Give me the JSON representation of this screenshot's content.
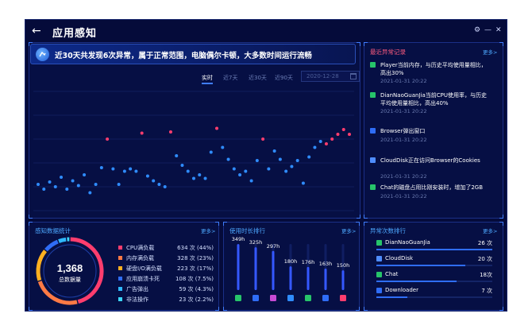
{
  "window": {
    "title": "应用感知",
    "back_label": "←",
    "settings_label": "⚙",
    "minimize_label": "—",
    "close_label": "✕"
  },
  "banner": {
    "text": "近30天共发现6次异常，属于正常范围，电脑偶尔卡顿，大多数时间运行流畅"
  },
  "time_tabs": [
    {
      "label": "实时",
      "active": true
    },
    {
      "label": "近7天",
      "active": false
    },
    {
      "label": "近30天",
      "active": false
    },
    {
      "label": "近90天",
      "active": false
    }
  ],
  "date_picker": {
    "value": "2020-12-28"
  },
  "chart_data": [
    {
      "type": "scatter",
      "title": "",
      "xlabel": "",
      "ylabel": "",
      "ylim": [
        0,
        100
      ],
      "grid": true,
      "normal_color": "#2f8cff",
      "abnormal_color": "#ff3d6e",
      "points": [
        {
          "x": 1,
          "y": 22,
          "abnormal": false
        },
        {
          "x": 2,
          "y": 18,
          "abnormal": false
        },
        {
          "x": 3,
          "y": 24,
          "abnormal": false
        },
        {
          "x": 4,
          "y": 20,
          "abnormal": false
        },
        {
          "x": 5,
          "y": 28,
          "abnormal": false
        },
        {
          "x": 6,
          "y": 18,
          "abnormal": false
        },
        {
          "x": 7,
          "y": 25,
          "abnormal": false
        },
        {
          "x": 8,
          "y": 21,
          "abnormal": false
        },
        {
          "x": 9,
          "y": 30,
          "abnormal": false
        },
        {
          "x": 10,
          "y": 15,
          "abnormal": false
        },
        {
          "x": 11,
          "y": 22,
          "abnormal": false
        },
        {
          "x": 12,
          "y": 36,
          "abnormal": false
        },
        {
          "x": 13,
          "y": 60,
          "abnormal": true
        },
        {
          "x": 14,
          "y": 35,
          "abnormal": false
        },
        {
          "x": 15,
          "y": 22,
          "abnormal": false
        },
        {
          "x": 16,
          "y": 33,
          "abnormal": false
        },
        {
          "x": 17,
          "y": 35,
          "abnormal": false
        },
        {
          "x": 18,
          "y": 33,
          "abnormal": false
        },
        {
          "x": 19,
          "y": 65,
          "abnormal": true
        },
        {
          "x": 20,
          "y": 29,
          "abnormal": false
        },
        {
          "x": 21,
          "y": 25,
          "abnormal": false
        },
        {
          "x": 22,
          "y": 22,
          "abnormal": false
        },
        {
          "x": 23,
          "y": 20,
          "abnormal": false
        },
        {
          "x": 24,
          "y": 66,
          "abnormal": true
        },
        {
          "x": 25,
          "y": 46,
          "abnormal": false
        },
        {
          "x": 26,
          "y": 38,
          "abnormal": false
        },
        {
          "x": 27,
          "y": 33,
          "abnormal": false
        },
        {
          "x": 28,
          "y": 27,
          "abnormal": false
        },
        {
          "x": 29,
          "y": 30,
          "abnormal": false
        },
        {
          "x": 30,
          "y": 27,
          "abnormal": false
        },
        {
          "x": 31,
          "y": 49,
          "abnormal": false
        },
        {
          "x": 32,
          "y": 69,
          "abnormal": true
        },
        {
          "x": 33,
          "y": 53,
          "abnormal": false
        },
        {
          "x": 34,
          "y": 43,
          "abnormal": false
        },
        {
          "x": 35,
          "y": 35,
          "abnormal": false
        },
        {
          "x": 36,
          "y": 30,
          "abnormal": false
        },
        {
          "x": 37,
          "y": 33,
          "abnormal": false
        },
        {
          "x": 38,
          "y": 25,
          "abnormal": false
        },
        {
          "x": 39,
          "y": 42,
          "abnormal": false
        },
        {
          "x": 40,
          "y": 60,
          "abnormal": true
        },
        {
          "x": 41,
          "y": 35,
          "abnormal": false
        },
        {
          "x": 42,
          "y": 50,
          "abnormal": false
        },
        {
          "x": 43,
          "y": 43,
          "abnormal": false
        },
        {
          "x": 44,
          "y": 33,
          "abnormal": false
        },
        {
          "x": 45,
          "y": 37,
          "abnormal": false
        },
        {
          "x": 46,
          "y": 42,
          "abnormal": false
        },
        {
          "x": 47,
          "y": 23,
          "abnormal": false
        },
        {
          "x": 48,
          "y": 45,
          "abnormal": false
        },
        {
          "x": 49,
          "y": 53,
          "abnormal": false
        },
        {
          "x": 50,
          "y": 58,
          "abnormal": false
        },
        {
          "x": 51,
          "y": 56,
          "abnormal": true
        },
        {
          "x": 52,
          "y": 60,
          "abnormal": true
        },
        {
          "x": 53,
          "y": 64,
          "abnormal": true
        },
        {
          "x": 54,
          "y": 68,
          "abnormal": true
        },
        {
          "x": 55,
          "y": 64,
          "abnormal": true
        }
      ]
    },
    {
      "type": "pie",
      "title": "感知数据统计",
      "center_value": "1,368",
      "center_label": "总数据量",
      "slices": [
        {
          "name": "CPU满负载",
          "value": 634,
          "label": "634 次 (44%)",
          "color": "#ff3d6e"
        },
        {
          "name": "内存满负载",
          "value": 328,
          "label": "328 次 (23%)",
          "color": "#ff7a45"
        },
        {
          "name": "硬盘I/O满负载",
          "value": 223,
          "label": "223 次 (17%)",
          "color": "#ffb020"
        },
        {
          "name": "应用崩溃卡死",
          "value": 108,
          "label": "108 次 (7.5%)",
          "color": "#2f6df6"
        },
        {
          "name": "广告弹出",
          "value": 59,
          "label": "59 次 (4.3%)",
          "color": "#2fb8ff"
        },
        {
          "name": "非法操作",
          "value": 23,
          "label": "23 次 (2.2%)",
          "color": "#3cd6ff"
        }
      ]
    },
    {
      "type": "bar",
      "title": "使用时长排行",
      "ylim": [
        0,
        350
      ],
      "categories": [
        "wechat",
        "360",
        "game",
        "cloud",
        "green",
        "download",
        "red"
      ],
      "values": [
        349,
        325,
        297,
        180,
        176,
        163,
        150
      ],
      "labels": [
        "349h",
        "325h",
        "297h",
        "180h",
        "176h",
        "163h",
        "150h"
      ],
      "icon_colors": [
        "#27c46a",
        "#2f6df6",
        "#c84bd6",
        "#2f8cff",
        "#27c46a",
        "#2f6df6",
        "#ff3d6e"
      ]
    }
  ],
  "more_label": "更多>",
  "records": {
    "title": "最近异常记录",
    "items": [
      {
        "text": "Player当前内存，与历史平均使用量相比，高出30%",
        "time": "2021-01-31 20:22",
        "icon": "green-app-icon",
        "color": "#27c46a"
      },
      {
        "text": "DianNaoGuanJia当前CPU使用率，与历史平均使用量相比，高出40%",
        "time": "2021-01-31 20:22",
        "icon": "green-app-icon",
        "color": "#27c46a"
      },
      {
        "text": "Browser弹出窗口",
        "time": "2021-01-31 20:22",
        "icon": "blue-app-icon",
        "color": "#2f6df6"
      },
      {
        "text": "CloudDisk正在访问Browser的Cookies",
        "time": "2021-01-31 20:22",
        "icon": "cloud-app-icon",
        "color": "#4f8dff"
      },
      {
        "text": "Chat的磁盘占用比刚安装时，增加了2GB",
        "time": "2021-01-31 20:22",
        "icon": "chat-app-icon",
        "color": "#27c46a"
      }
    ]
  },
  "anomaly_ranking": {
    "title": "异常次数排行",
    "items": [
      {
        "name": "DianNaoGuanJia",
        "count": "26 次",
        "value": 26,
        "color": "#27c46a"
      },
      {
        "name": "CloudDisk",
        "count": "20 次",
        "value": 20,
        "color": "#4f8dff"
      },
      {
        "name": "Chat",
        "count": "18次",
        "value": 18,
        "color": "#27c46a"
      },
      {
        "name": "Downloader",
        "count": "7 次",
        "value": 7,
        "color": "#2f6df6"
      }
    ]
  }
}
